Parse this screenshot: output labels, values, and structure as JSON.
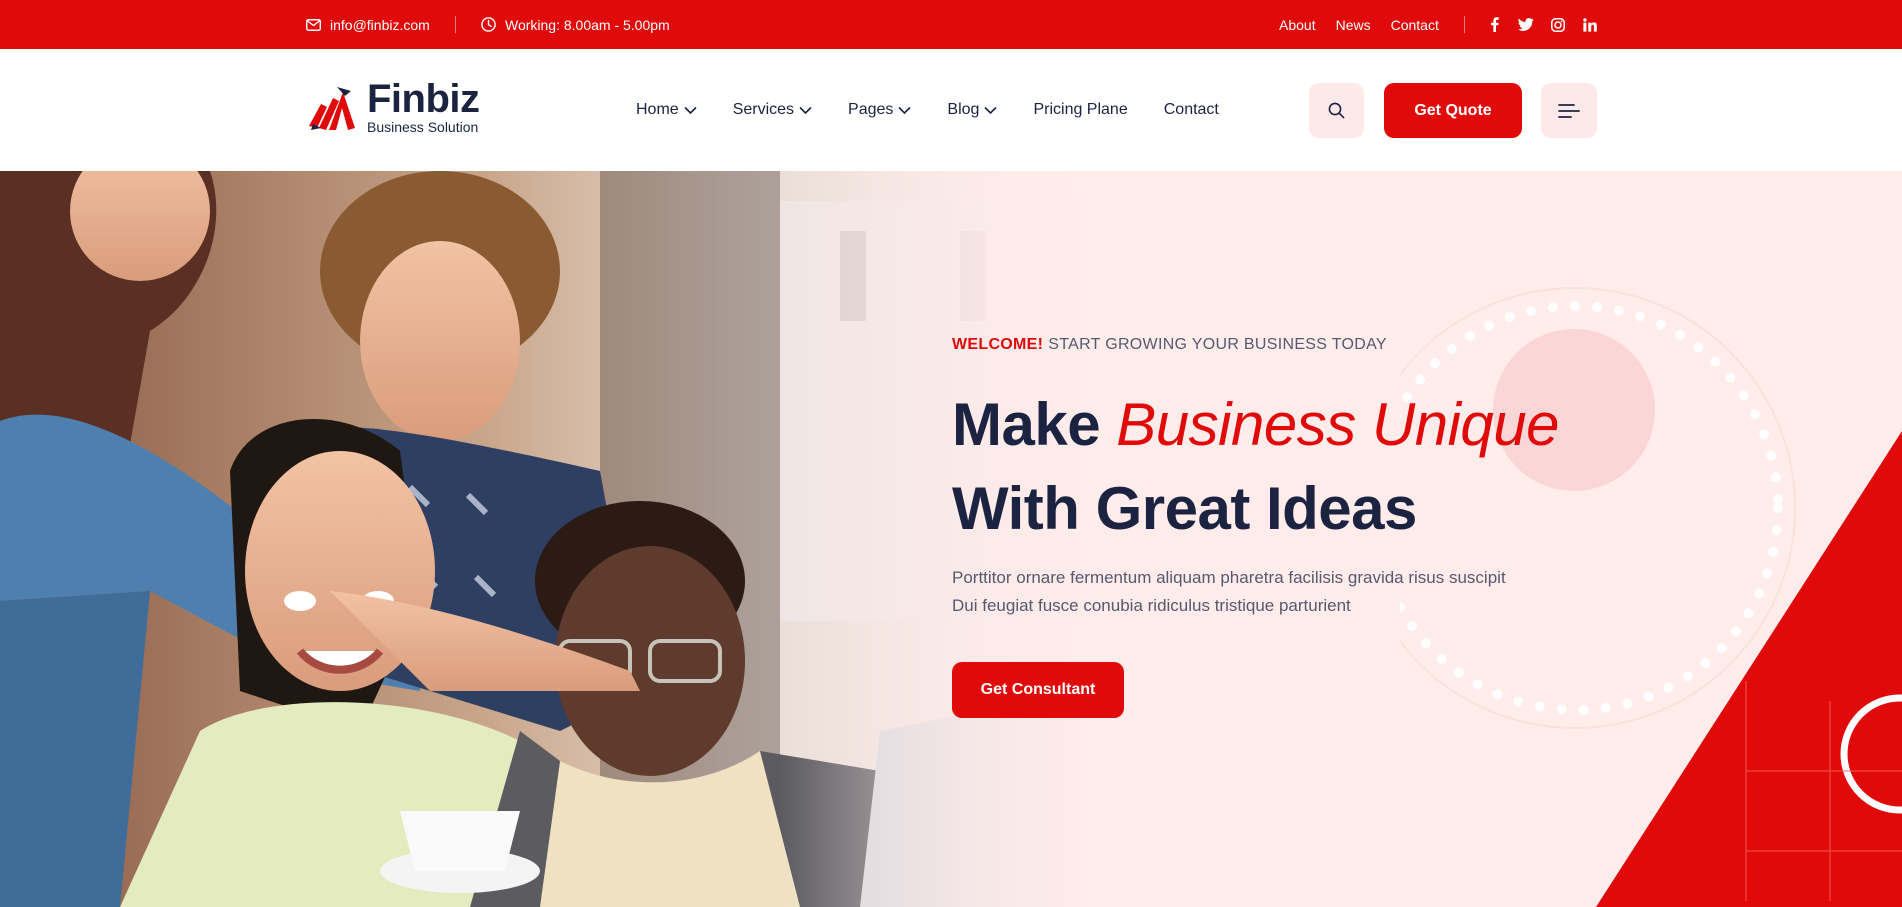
{
  "topbar": {
    "email": "info@finbiz.com",
    "hours": "Working: 8.00am - 5.00pm",
    "links": [
      "About",
      "News",
      "Contact"
    ],
    "social": [
      "facebook-icon",
      "twitter-icon",
      "instagram-icon",
      "linkedin-icon"
    ]
  },
  "brand": {
    "name": "Finbiz",
    "tagline": "Business Solution"
  },
  "nav": {
    "items": [
      {
        "label": "Home",
        "dropdown": true
      },
      {
        "label": "Services",
        "dropdown": true
      },
      {
        "label": "Pages",
        "dropdown": true
      },
      {
        "label": "Blog",
        "dropdown": true
      },
      {
        "label": "Pricing Plane",
        "dropdown": false
      },
      {
        "label": "Contact",
        "dropdown": false
      }
    ],
    "quote_label": "Get Quote"
  },
  "hero": {
    "kicker_accent": "WELCOME!",
    "kicker_text": "START GROWING YOUR BUSINESS TODAY",
    "title_line1_plain": "Make",
    "title_line1_accent": "Business Unique",
    "title_line2": "With Great Ideas",
    "lead_line1": "Porttitor ornare fermentum aliquam pharetra facilisis gravida risus suscipit",
    "lead_line2": "Dui feugiat fusce conubia ridiculus tristique parturient",
    "cta_label": "Get Consultant"
  },
  "colors": {
    "brand_red": "#e10a0a",
    "navy": "#1c2340",
    "hero_bg": "#ffeceb",
    "soft_pink": "#fde9e9"
  }
}
